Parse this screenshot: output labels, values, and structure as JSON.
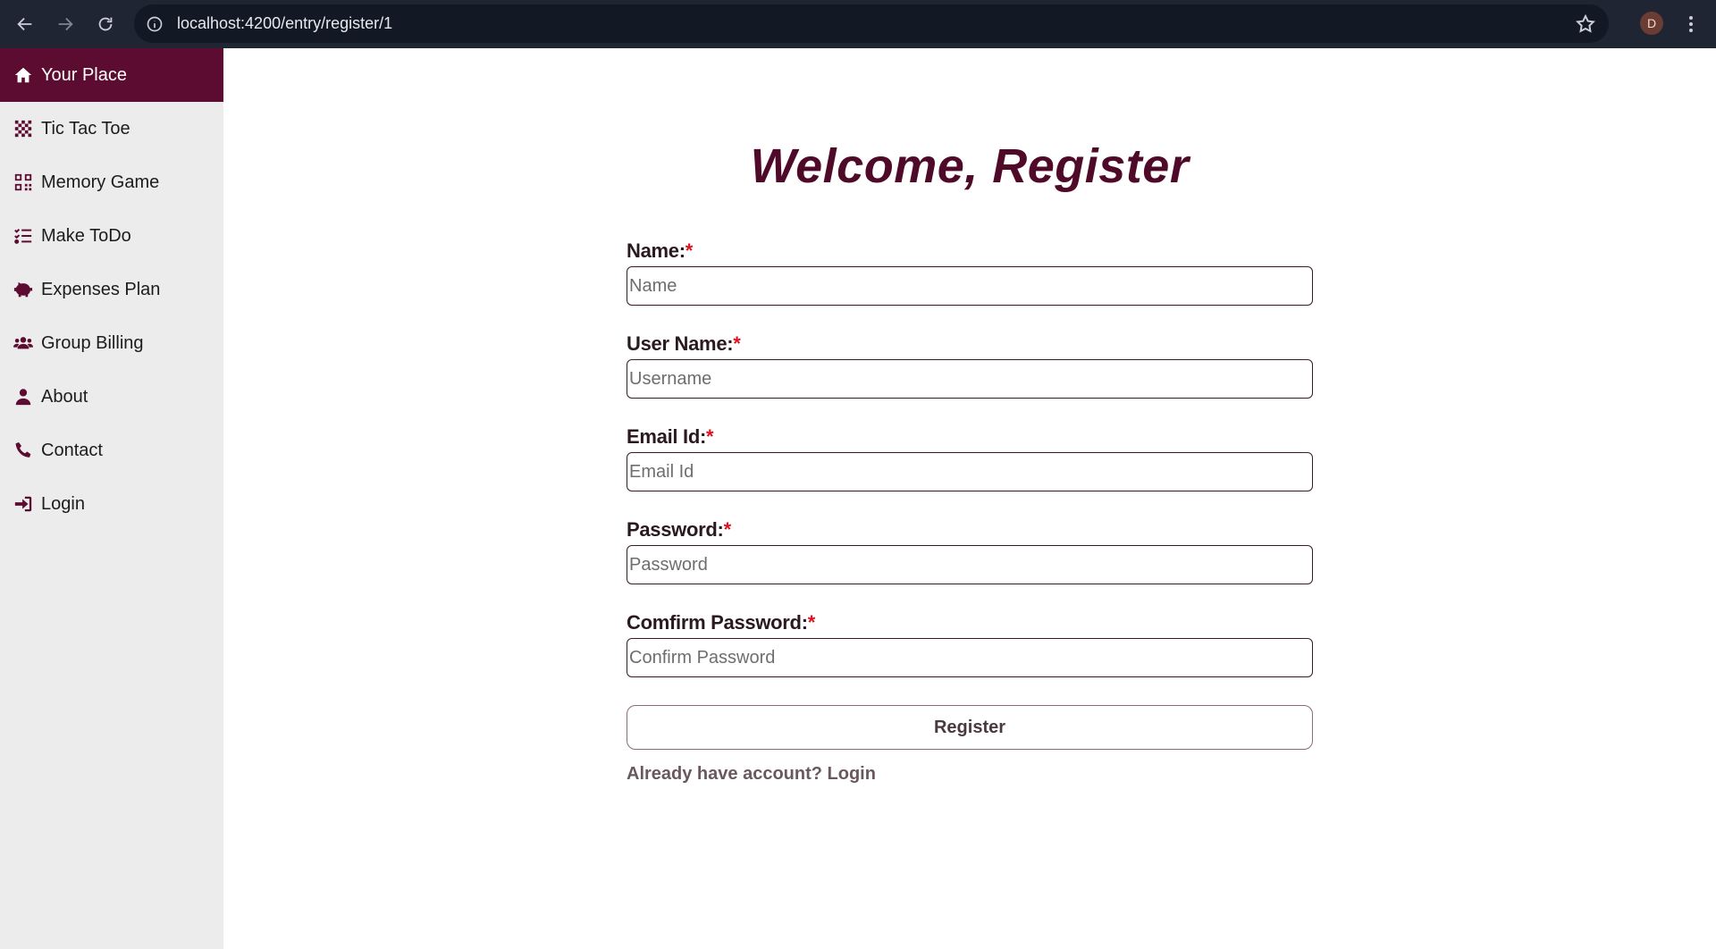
{
  "browser": {
    "url": "localhost:4200/entry/register/1",
    "profile_initial": "D"
  },
  "sidebar": {
    "items": [
      {
        "label": "Your Place",
        "icon": "home-icon",
        "active": true
      },
      {
        "label": "Tic Tac Toe",
        "icon": "checkerboard-icon"
      },
      {
        "label": "Memory Game",
        "icon": "qrcode-icon"
      },
      {
        "label": "Make ToDo",
        "icon": "checklist-icon"
      },
      {
        "label": "Expenses Plan",
        "icon": "piggy-bank-icon"
      },
      {
        "label": "Group Billing",
        "icon": "users-icon"
      },
      {
        "label": "About",
        "icon": "user-icon"
      },
      {
        "label": "Contact",
        "icon": "phone-icon"
      },
      {
        "label": "Login",
        "icon": "sign-in-icon"
      }
    ]
  },
  "main": {
    "title": "Welcome, Register",
    "fields": [
      {
        "label": "Name:",
        "required": "*",
        "placeholder": "Name"
      },
      {
        "label": "User Name:",
        "required": "*",
        "placeholder": "Username"
      },
      {
        "label": "Email Id:",
        "required": "*",
        "placeholder": "Email Id"
      },
      {
        "label": "Password:",
        "required": "*",
        "placeholder": "Password"
      },
      {
        "label": "Comfirm Password:",
        "required": "*",
        "placeholder": "Confirm Password"
      }
    ],
    "register_label": "Register",
    "login_link": "Already have account? Login"
  },
  "colors": {
    "brand": "#5c0c30",
    "sidebar_bg": "#ececec",
    "required": "#e01020"
  }
}
